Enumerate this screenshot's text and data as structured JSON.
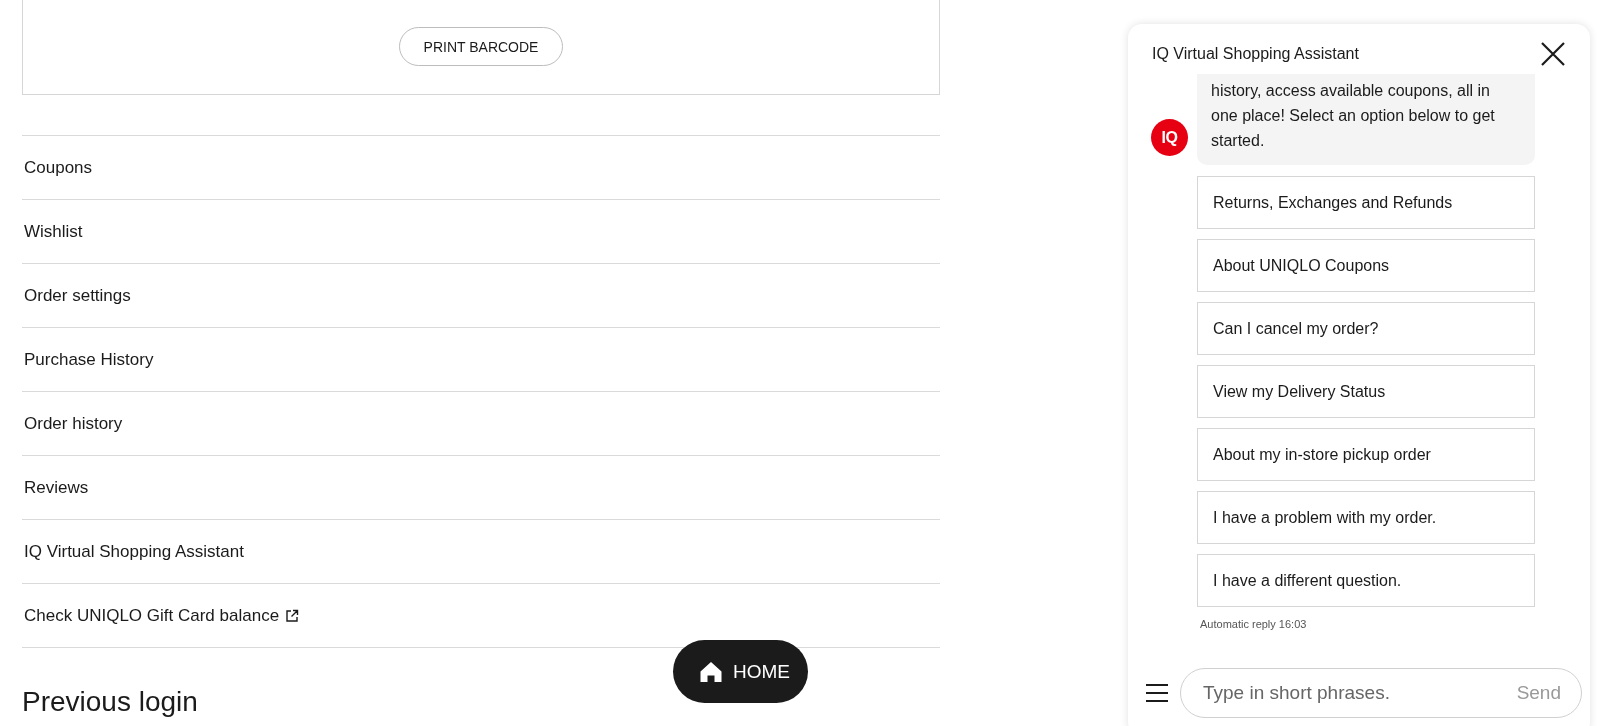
{
  "barcode_card": {
    "button": "PRINT BARCODE"
  },
  "menu_items": [
    {
      "label": "Coupons",
      "external": false
    },
    {
      "label": "Wishlist",
      "external": false
    },
    {
      "label": "Order settings",
      "external": false
    },
    {
      "label": "Purchase History",
      "external": false
    },
    {
      "label": "Order history",
      "external": false
    },
    {
      "label": "Reviews",
      "external": false
    },
    {
      "label": "IQ Virtual Shopping Assistant",
      "external": false
    },
    {
      "label": "Check UNIQLO Gift Card balance",
      "external": true
    }
  ],
  "section_heading": "Previous login",
  "home_button": {
    "label": "HOME"
  },
  "chat": {
    "title": "IQ Virtual Shopping Assistant",
    "avatar": "IQ",
    "message": "history, access available coupons, all in one place! Select an option below to get started.",
    "options": [
      "Returns, Exchanges and Refunds",
      "About UNIQLO Coupons",
      "Can I cancel my order?",
      "View my Delivery Status",
      "About my in-store pickup order",
      "I have a problem with my order.",
      "I have a different question."
    ],
    "timestamp": "Automatic reply 16:03",
    "input": {
      "placeholder": "Type in short phrases."
    },
    "send_button": "Send"
  }
}
